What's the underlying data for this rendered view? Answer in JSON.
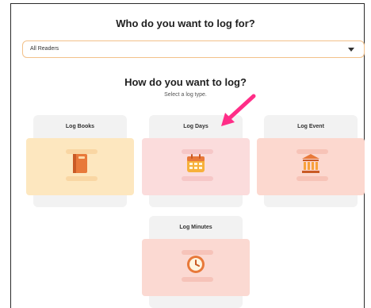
{
  "header": {
    "who_title": "Who do you want to log for?"
  },
  "reader_select": {
    "value": "All Readers"
  },
  "log_type": {
    "title": "How do you want to log?",
    "subtitle": "Select a log type."
  },
  "cards": [
    {
      "label": "Log Books",
      "icon": "book-icon"
    },
    {
      "label": "Log Days",
      "icon": "calendar-icon"
    },
    {
      "label": "Log Event",
      "icon": "building-icon"
    },
    {
      "label": "Log Minutes",
      "icon": "clock-icon"
    }
  ],
  "colors": {
    "accent": "#ff2d87",
    "select_border": "#f2c18a",
    "book_bg": "#fde7bf",
    "days_bg": "#fbdcdc",
    "event_bg": "#fcd8cf",
    "minutes_bg": "#fbd9d2"
  }
}
